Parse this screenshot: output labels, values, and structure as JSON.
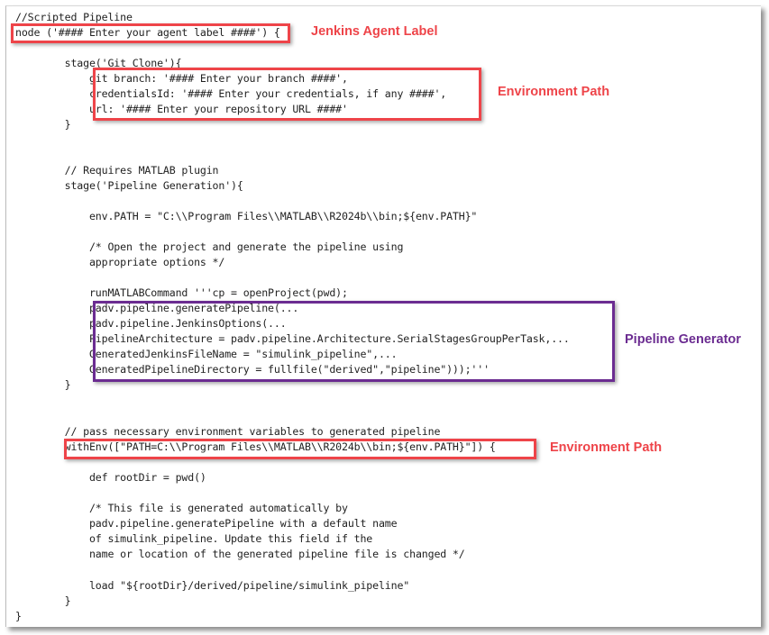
{
  "code_lines": [
    "//Scripted Pipeline",
    "node ('#### Enter your agent label ####') {",
    "",
    "        stage('Git Clone'){",
    "            git branch: '#### Enter your branch ####',",
    "            credentialsId: '#### Enter your credentials, if any ####',",
    "            url: '#### Enter your repository URL ####'",
    "        }",
    "",
    "",
    "        // Requires MATLAB plugin",
    "        stage('Pipeline Generation'){",
    "",
    "            env.PATH = \"C:\\\\Program Files\\\\MATLAB\\\\R2024b\\\\bin;${env.PATH}\"",
    "",
    "            /* Open the project and generate the pipeline using",
    "            appropriate options */",
    "",
    "            runMATLABCommand '''cp = openProject(pwd);",
    "            padv.pipeline.generatePipeline(...",
    "            padv.pipeline.JenkinsOptions(...",
    "            PipelineArchitecture = padv.pipeline.Architecture.SerialStagesGroupPerTask,...",
    "            GeneratedJenkinsFileName = \"simulink_pipeline\",...",
    "            GeneratedPipelineDirectory = fullfile(\"derived\",\"pipeline\")));'''",
    "        }",
    "",
    "",
    "        // pass necessary environment variables to generated pipeline",
    "        withEnv([\"PATH=C:\\\\Program Files\\\\MATLAB\\\\R2024b\\\\bin;${env.PATH}\"]) {",
    "",
    "            def rootDir = pwd()",
    "",
    "            /* This file is generated automatically by",
    "            padv.pipeline.generatePipeline with a default name",
    "            of simulink_pipeline. Update this field if the",
    "            name or location of the generated pipeline file is changed */",
    "",
    "            load \"${rootDir}/derived/pipeline/simulink_pipeline\"",
    "        }",
    "}"
  ],
  "annotations": {
    "agent_label": "Jenkins Agent Label",
    "git_env_path": "Environment Path",
    "pipeline_generator": "Pipeline Generator",
    "withenv_env_path": "Environment Path"
  },
  "colors": {
    "highlight_red": "#ee4449",
    "highlight_purple": "#6b2c91"
  }
}
